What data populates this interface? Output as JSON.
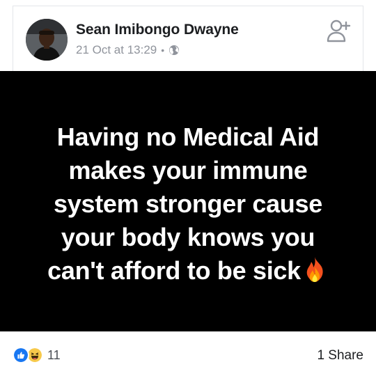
{
  "post": {
    "author_name": "Sean Imibongo Dwayne",
    "timestamp": "21 Oct at 13:29",
    "meta_separator": "•",
    "privacy_icon": "globe-icon",
    "header_action_icon": "add-friend-icon",
    "image_text_lines": [
      "Having no Medical Aid",
      "makes your immune",
      "system stronger cause",
      "your body knows you",
      "can't afford to be sick"
    ],
    "image_emoji": "fire-emoji"
  },
  "footer": {
    "reaction_icons": [
      "like-icon",
      "haha-icon"
    ],
    "reaction_count": "11",
    "share_count": "1 Share"
  },
  "colors": {
    "image_background": "#000000",
    "image_text": "#ffffff",
    "like_blue": "#1877f2",
    "haha_yellow": "#f7c94b",
    "meta_gray": "#90949c"
  }
}
